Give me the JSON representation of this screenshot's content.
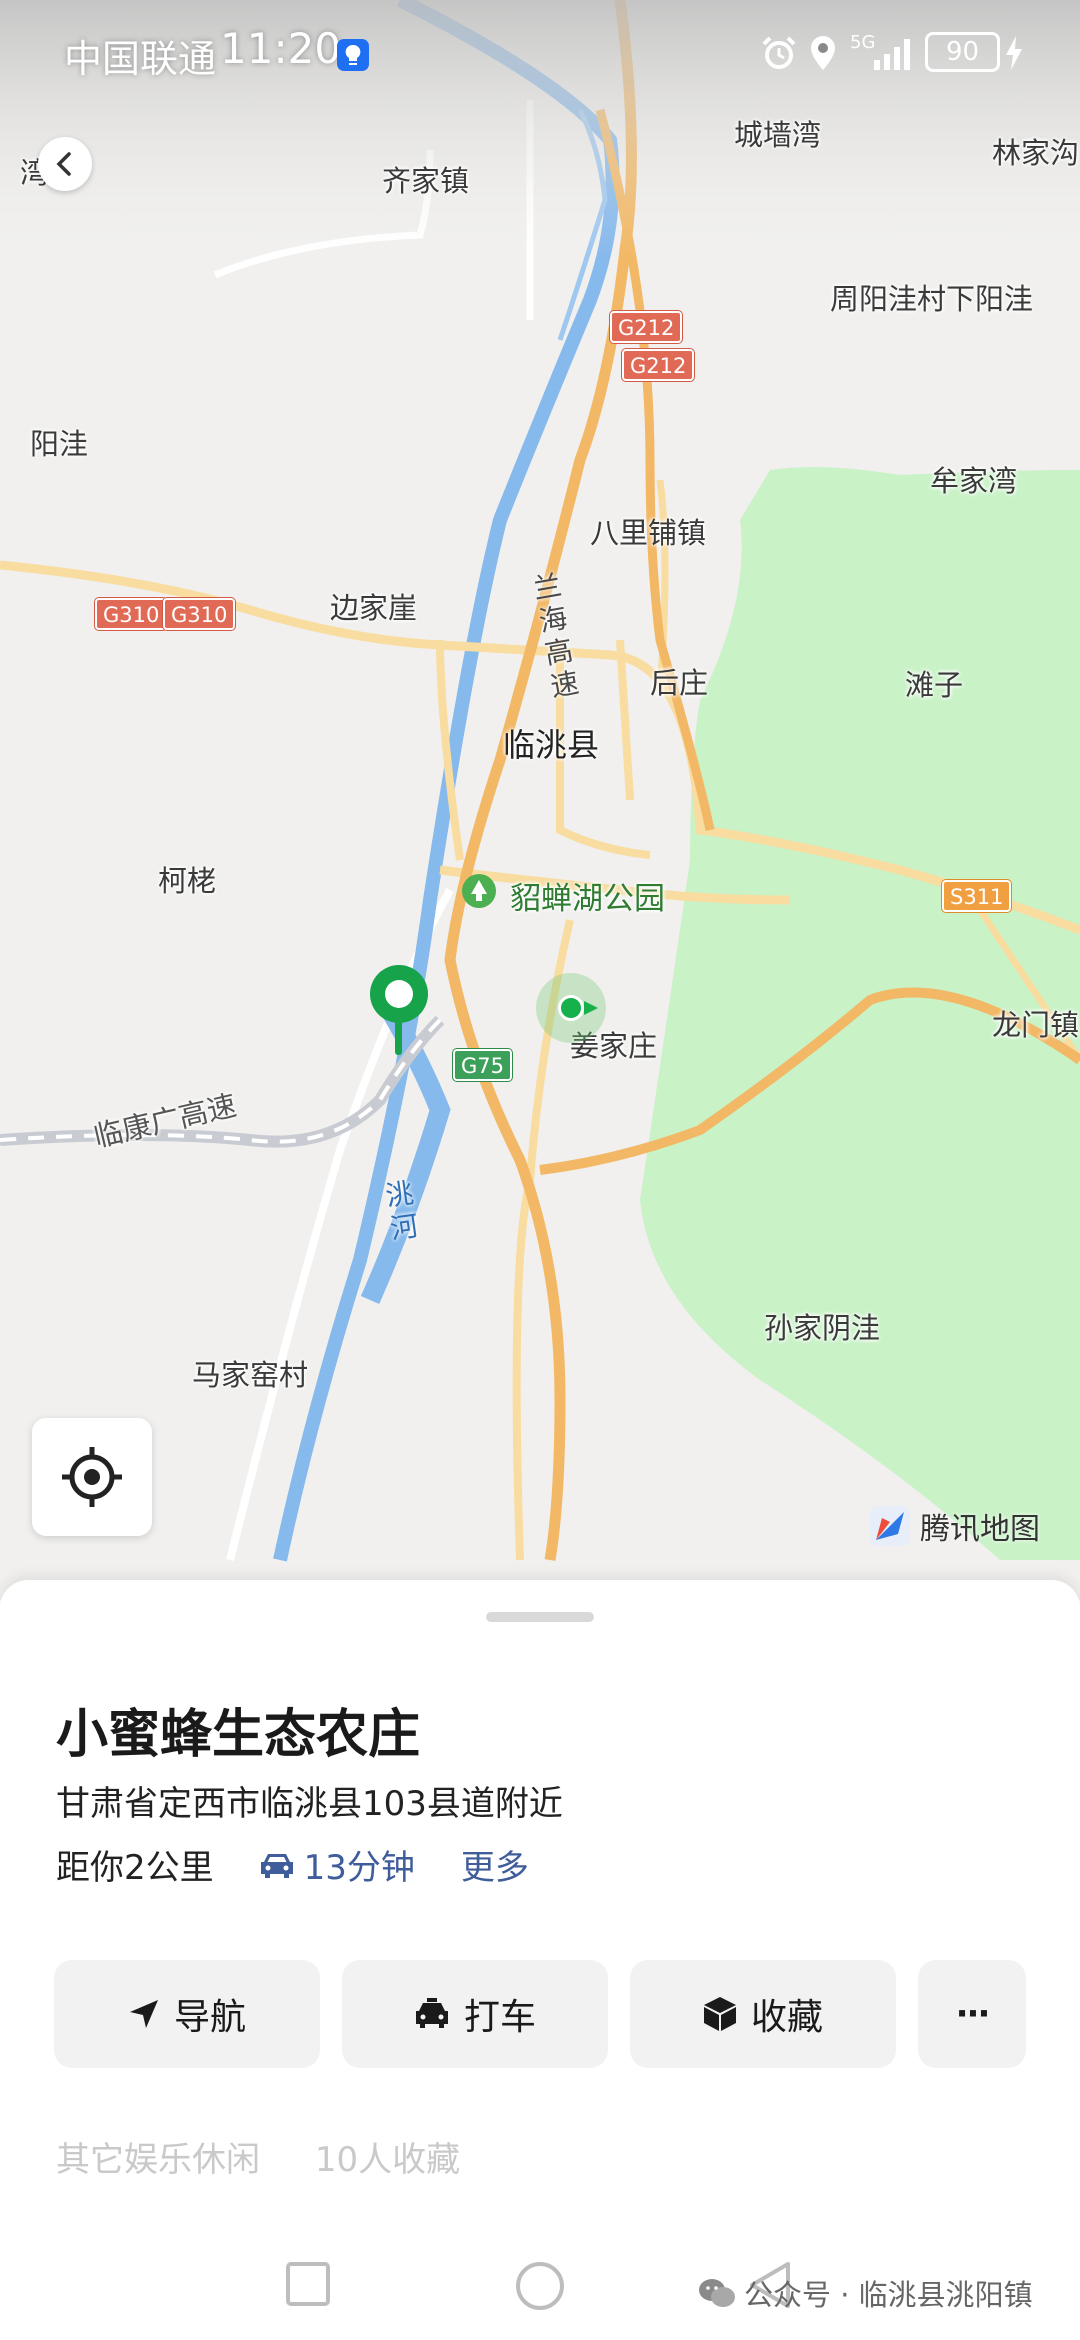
{
  "status_bar": {
    "carrier": "中国联通",
    "time": "11:20",
    "network": "5G",
    "battery": "90"
  },
  "map": {
    "provider": "腾讯地图",
    "places": {
      "chengqiangwan": "城墙湾",
      "linjiagou": "林家沟",
      "qijiazhen": "齐家镇",
      "zhouyangwa": "周阳洼村下阳洼",
      "yangwa": "阳洼",
      "moujiawan": "牟家湾",
      "balipuzhen": "八里铺镇",
      "bianjiaya": "边家崖",
      "houzhuang": "后庄",
      "tanzi": "滩子",
      "lintaoxian": "临洮县",
      "kelao": "柯栳",
      "diaochanhu": "貂蝉湖公园",
      "jiangjiazhuang": "姜家庄",
      "longmenzhen": "龙门镇",
      "sunjiayinwa": "孙家阴洼",
      "majiayaocun": "马家窑村",
      "partial_left": "湾"
    },
    "roads": {
      "lanhai_vertical": [
        "兰",
        "海",
        "高",
        "速"
      ],
      "lingkangguang": "临康广高速",
      "river": [
        "洮",
        "河"
      ]
    },
    "shields": {
      "g212_a": "G212",
      "g212_b": "G212",
      "g310_a": "G310",
      "g310_b": "G310",
      "g75": "G75",
      "s311": "S311"
    }
  },
  "sheet": {
    "name": "小蜜蜂生态农庄",
    "address": "甘肃省定西市临洮县103县道附近",
    "distance": "距你2公里",
    "drive_time": "13分钟",
    "more": "更多",
    "actions": {
      "navigate": "导航",
      "taxi": "打车",
      "favorite": "收藏",
      "more": "···"
    },
    "category": "其它娱乐休闲",
    "favorites_count": "10人收藏"
  },
  "watermark": "公众号 · 临洮县洮阳镇"
}
